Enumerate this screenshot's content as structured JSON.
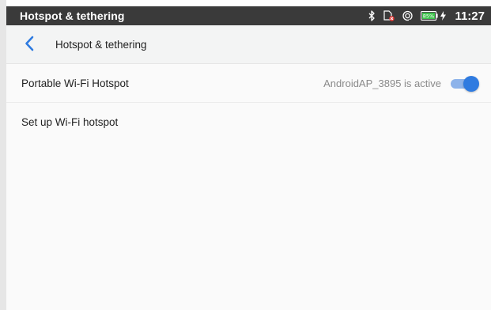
{
  "status_bar": {
    "title": "Hotspot & tethering",
    "time": "11:27",
    "battery_text": "85%",
    "icons": [
      "bluetooth-icon",
      "no-sim-icon",
      "hotspot-icon",
      "battery-icon",
      "charging-icon"
    ]
  },
  "app_bar": {
    "title": "Hotspot & tethering",
    "back_icon": "chevron-left-icon"
  },
  "settings": {
    "portable_hotspot": {
      "label": "Portable Wi-Fi Hotspot",
      "status": "AndroidAP_3895 is active",
      "enabled": true
    },
    "setup_hotspot": {
      "label": "Set up Wi-Fi hotspot"
    }
  },
  "colors": {
    "accent": "#2f7be0",
    "status_bar_bg": "#3a3a3a",
    "app_bar_bg": "#f3f4f4",
    "battery_green": "#3cc24a",
    "alert_red": "#e53935"
  }
}
